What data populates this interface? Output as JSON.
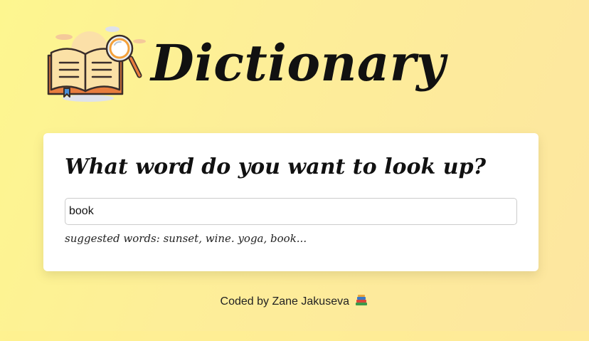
{
  "header": {
    "title": "Dictionary",
    "logo_icon": "book-magnifier-icon"
  },
  "search": {
    "question": "What word do you want to look up?",
    "value": "book",
    "hint": "suggested words: sunset, wine. yoga, book..."
  },
  "footer": {
    "text": "Coded by Zane Jakuseva",
    "icon": "books-icon"
  },
  "colors": {
    "background_start": "#fdf68f",
    "background_end": "#fde6a0",
    "card": "#ffffff",
    "book_cover": "#e87d3e",
    "book_pages": "#fbe1a6",
    "lens_rim": "#f4a13b"
  }
}
